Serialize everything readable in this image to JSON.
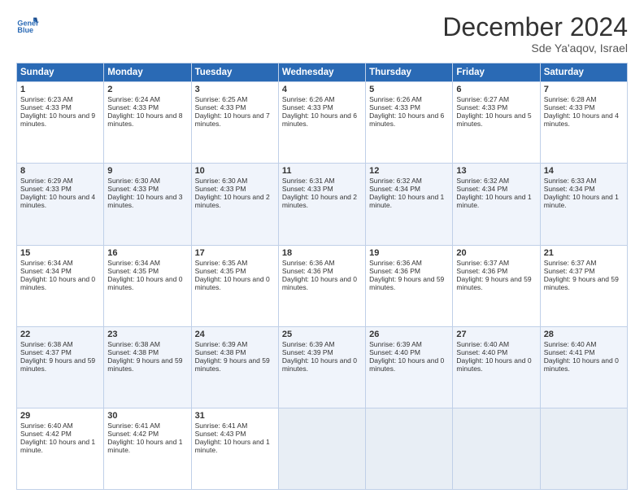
{
  "header": {
    "logo_line1": "General",
    "logo_line2": "Blue",
    "month": "December 2024",
    "location": "Sde Ya'aqov, Israel"
  },
  "days_of_week": [
    "Sunday",
    "Monday",
    "Tuesday",
    "Wednesday",
    "Thursday",
    "Friday",
    "Saturday"
  ],
  "weeks": [
    [
      {
        "day": 1,
        "sunrise": "6:23 AM",
        "sunset": "4:33 PM",
        "daylight": "10 hours and 9 minutes."
      },
      {
        "day": 2,
        "sunrise": "6:24 AM",
        "sunset": "4:33 PM",
        "daylight": "10 hours and 8 minutes."
      },
      {
        "day": 3,
        "sunrise": "6:25 AM",
        "sunset": "4:33 PM",
        "daylight": "10 hours and 7 minutes."
      },
      {
        "day": 4,
        "sunrise": "6:26 AM",
        "sunset": "4:33 PM",
        "daylight": "10 hours and 6 minutes."
      },
      {
        "day": 5,
        "sunrise": "6:26 AM",
        "sunset": "4:33 PM",
        "daylight": "10 hours and 6 minutes."
      },
      {
        "day": 6,
        "sunrise": "6:27 AM",
        "sunset": "4:33 PM",
        "daylight": "10 hours and 5 minutes."
      },
      {
        "day": 7,
        "sunrise": "6:28 AM",
        "sunset": "4:33 PM",
        "daylight": "10 hours and 4 minutes."
      }
    ],
    [
      {
        "day": 8,
        "sunrise": "6:29 AM",
        "sunset": "4:33 PM",
        "daylight": "10 hours and 4 minutes."
      },
      {
        "day": 9,
        "sunrise": "6:30 AM",
        "sunset": "4:33 PM",
        "daylight": "10 hours and 3 minutes."
      },
      {
        "day": 10,
        "sunrise": "6:30 AM",
        "sunset": "4:33 PM",
        "daylight": "10 hours and 2 minutes."
      },
      {
        "day": 11,
        "sunrise": "6:31 AM",
        "sunset": "4:33 PM",
        "daylight": "10 hours and 2 minutes."
      },
      {
        "day": 12,
        "sunrise": "6:32 AM",
        "sunset": "4:34 PM",
        "daylight": "10 hours and 1 minute."
      },
      {
        "day": 13,
        "sunrise": "6:32 AM",
        "sunset": "4:34 PM",
        "daylight": "10 hours and 1 minute."
      },
      {
        "day": 14,
        "sunrise": "6:33 AM",
        "sunset": "4:34 PM",
        "daylight": "10 hours and 1 minute."
      }
    ],
    [
      {
        "day": 15,
        "sunrise": "6:34 AM",
        "sunset": "4:34 PM",
        "daylight": "10 hours and 0 minutes."
      },
      {
        "day": 16,
        "sunrise": "6:34 AM",
        "sunset": "4:35 PM",
        "daylight": "10 hours and 0 minutes."
      },
      {
        "day": 17,
        "sunrise": "6:35 AM",
        "sunset": "4:35 PM",
        "daylight": "10 hours and 0 minutes."
      },
      {
        "day": 18,
        "sunrise": "6:36 AM",
        "sunset": "4:36 PM",
        "daylight": "10 hours and 0 minutes."
      },
      {
        "day": 19,
        "sunrise": "6:36 AM",
        "sunset": "4:36 PM",
        "daylight": "9 hours and 59 minutes."
      },
      {
        "day": 20,
        "sunrise": "6:37 AM",
        "sunset": "4:36 PM",
        "daylight": "9 hours and 59 minutes."
      },
      {
        "day": 21,
        "sunrise": "6:37 AM",
        "sunset": "4:37 PM",
        "daylight": "9 hours and 59 minutes."
      }
    ],
    [
      {
        "day": 22,
        "sunrise": "6:38 AM",
        "sunset": "4:37 PM",
        "daylight": "9 hours and 59 minutes."
      },
      {
        "day": 23,
        "sunrise": "6:38 AM",
        "sunset": "4:38 PM",
        "daylight": "9 hours and 59 minutes."
      },
      {
        "day": 24,
        "sunrise": "6:39 AM",
        "sunset": "4:38 PM",
        "daylight": "9 hours and 59 minutes."
      },
      {
        "day": 25,
        "sunrise": "6:39 AM",
        "sunset": "4:39 PM",
        "daylight": "10 hours and 0 minutes."
      },
      {
        "day": 26,
        "sunrise": "6:39 AM",
        "sunset": "4:40 PM",
        "daylight": "10 hours and 0 minutes."
      },
      {
        "day": 27,
        "sunrise": "6:40 AM",
        "sunset": "4:40 PM",
        "daylight": "10 hours and 0 minutes."
      },
      {
        "day": 28,
        "sunrise": "6:40 AM",
        "sunset": "4:41 PM",
        "daylight": "10 hours and 0 minutes."
      }
    ],
    [
      {
        "day": 29,
        "sunrise": "6:40 AM",
        "sunset": "4:42 PM",
        "daylight": "10 hours and 1 minute."
      },
      {
        "day": 30,
        "sunrise": "6:41 AM",
        "sunset": "4:42 PM",
        "daylight": "10 hours and 1 minute."
      },
      {
        "day": 31,
        "sunrise": "6:41 AM",
        "sunset": "4:43 PM",
        "daylight": "10 hours and 1 minute."
      },
      null,
      null,
      null,
      null
    ]
  ],
  "labels": {
    "sunrise": "Sunrise:",
    "sunset": "Sunset:",
    "daylight": "Daylight:"
  }
}
